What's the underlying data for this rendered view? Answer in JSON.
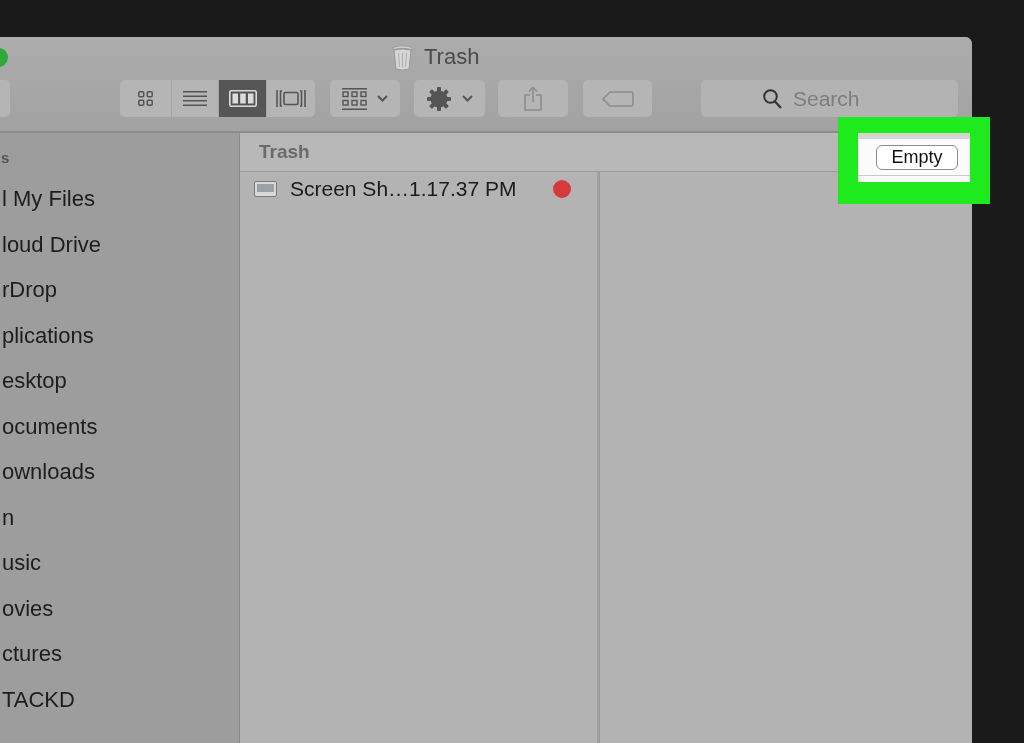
{
  "window": {
    "title": "Trash"
  },
  "toolbar": {
    "view_modes": [
      {
        "kind": "icon",
        "selected": false
      },
      {
        "kind": "list",
        "selected": false
      },
      {
        "kind": "column",
        "selected": true
      },
      {
        "kind": "cover_flow",
        "selected": false
      }
    ],
    "search": {
      "placeholder": "Search"
    }
  },
  "sidebar": {
    "section_label": "s",
    "items": [
      {
        "label": "l My Files"
      },
      {
        "label": "loud Drive"
      },
      {
        "label": "rDrop"
      },
      {
        "label": "plications"
      },
      {
        "label": "esktop"
      },
      {
        "label": "ocuments"
      },
      {
        "label": "ownloads"
      },
      {
        "label": "n"
      },
      {
        "label": "usic"
      },
      {
        "label": "ovies"
      },
      {
        "label": "ctures"
      },
      {
        "label": "TACKD"
      }
    ]
  },
  "browser": {
    "path_header": "Trash",
    "files": [
      {
        "name": "Screen Sh…1.17.37 PM",
        "color": "#d63a3a"
      }
    ]
  },
  "highlight": {
    "button_label": "Empty"
  }
}
